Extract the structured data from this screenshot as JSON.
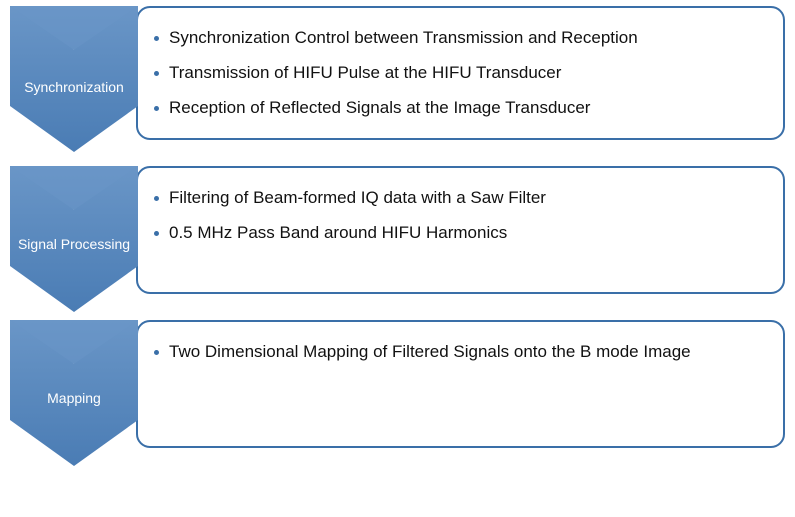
{
  "steps": [
    {
      "label": "Synchronization",
      "bullets": [
        "Synchronization Control between Transmission and Reception",
        "Transmission of HIFU Pulse at the HIFU Transducer",
        "Reception of Reflected Signals at the Image Transducer"
      ]
    },
    {
      "label": "Signal Processing",
      "bullets": [
        "Filtering of Beam-formed IQ data with a Saw Filter",
        "0.5 MHz Pass Band around HIFU Harmonics"
      ]
    },
    {
      "label": "Mapping",
      "bullets": [
        "Two Dimensional Mapping of Filtered Signals onto the B mode Image"
      ]
    }
  ],
  "colors": {
    "chevron_fill": "#5889bd",
    "chevron_edge": "#3a6fa8",
    "box_border": "#3a6fa8"
  }
}
